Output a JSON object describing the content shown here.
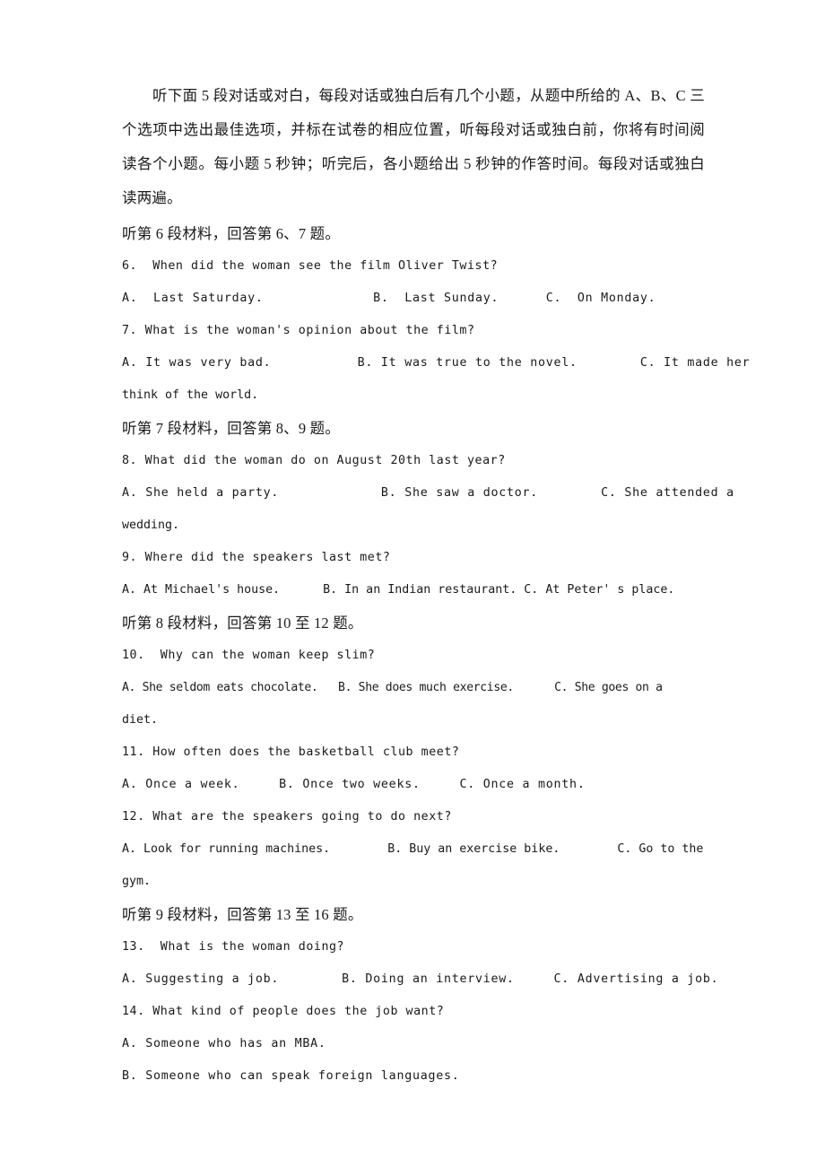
{
  "document": {
    "type": "listening-comprehension-exam",
    "language": "zh-CN + en",
    "page_background": "#ffffff",
    "text_color": "#1a1a1a"
  },
  "directions": {
    "paragraph": "听下面 5 段对话或对白，每段对话或独白后有几个小题，从题中所给的 A、B、C 三个选项中选出最佳选项，并标在试卷的相应位置，听每段对话或独白前，你将有时间阅读各个小题。每小题 5 秒钟；听完后，各小题给出 5 秒钟的作答时间。每段对话或独白读两遍。"
  },
  "sections": [
    {
      "heading": "听第 6 段材料，回答第 6、7 题。",
      "questions": [
        {
          "number": "6.",
          "stem": "6.  When did the woman see the film Oliver Twist?",
          "options_line": "A.  Last Saturday.              B.  Last Sunday.      C.  On Monday.",
          "continuation": null
        },
        {
          "number": "7.",
          "stem": "7. What is the woman's opinion about the film?",
          "options_line": "A. It was very bad.           B. It was true to the novel.        C. It made her",
          "continuation": "think of the world."
        }
      ]
    },
    {
      "heading": "听第 7 段材料，回答第 8、9 题。",
      "questions": [
        {
          "number": "8.",
          "stem": "8. What did the woman do on August 20th last year?",
          "options_line": "A. She held a party.             B. She saw a doctor.        C. She attended a",
          "continuation": "wedding."
        },
        {
          "number": "9.",
          "stem": "9. Where did the speakers last met?",
          "options_line": "A. At Michael's house.      B. In an Indian restaurant. C. At Peter' s place.",
          "continuation": null
        }
      ]
    },
    {
      "heading": "听第 8 段材料，回答第 10 至 12 题。",
      "questions": [
        {
          "number": "10.",
          "stem": "10.  Why can the woman keep slim?",
          "options_line": "A. She seldom eats chocolate.   B. She does much exercise.      C. She goes on a",
          "continuation": "diet."
        },
        {
          "number": "11.",
          "stem": "11. How often does the basketball club meet?",
          "options_line": "A. Once a week.     B. Once two weeks.     C. Once a month.",
          "continuation": null
        },
        {
          "number": "12.",
          "stem": "12. What are the speakers going to do next?",
          "options_line": "A. Look for running machines.        B. Buy an exercise bike.        C. Go to the",
          "continuation": "gym."
        }
      ]
    },
    {
      "heading": "听第 9 段材料，回答第 13 至 16 题。",
      "questions": [
        {
          "number": "13.",
          "stem": "13.  What is the woman doing?",
          "options_line": "A. Suggesting a job.        B. Doing an interview.     C. Advertising a job.",
          "continuation": null
        },
        {
          "number": "14.",
          "stem": "14. What kind of people does the job want?",
          "options_line": "A. Someone who has an MBA.",
          "option_b": "B. Someone who can speak foreign languages.",
          "continuation": null
        }
      ]
    }
  ]
}
